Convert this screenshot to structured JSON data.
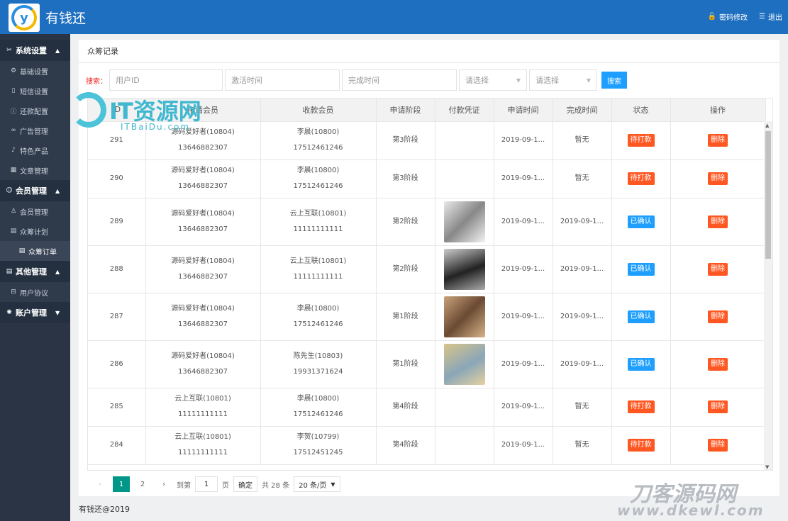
{
  "header": {
    "logo_letter": "y",
    "title": "有钱还",
    "pwd_link": "密码修改",
    "logout_link": "退出"
  },
  "sidebar": {
    "groups": [
      {
        "label": "系统设置",
        "items": [
          "基础设置",
          "短信设置",
          "还款配置",
          "广告管理",
          "特色产品",
          "文章管理"
        ]
      },
      {
        "label": "会员管理",
        "items": [
          "会员管理",
          "众筹计划",
          "众筹订单"
        ]
      },
      {
        "label": "其他管理",
        "items": [
          "用户协议"
        ]
      },
      {
        "label": "账户管理",
        "items": []
      }
    ]
  },
  "panel": {
    "title": "众筹记录"
  },
  "search": {
    "label": "搜索：",
    "user_id_placeholder": "用户ID",
    "activate_placeholder": "激活时间",
    "finish_placeholder": "完成时间",
    "select1": "请选择",
    "select2": "请选择",
    "button": "搜索"
  },
  "table": {
    "headers": [
      "ID",
      "申请会员",
      "收款会员",
      "申请阶段",
      "付款凭证",
      "申请时间",
      "完成时间",
      "状态",
      "操作"
    ],
    "rows": [
      {
        "id": "291",
        "applicant": "源码爱好者(10804)",
        "applicant_phone": "13646882307",
        "payee": "李晨(10800)",
        "payee_phone": "17512461246",
        "stage": "第3阶段",
        "apply": "2019-09-1...",
        "finish": "暂无",
        "status": "待打款",
        "action": "删除"
      },
      {
        "id": "290",
        "applicant": "源码爱好者(10804)",
        "applicant_phone": "13646882307",
        "payee": "李晨(10800)",
        "payee_phone": "17512461246",
        "stage": "第3阶段",
        "apply": "2019-09-1...",
        "finish": "暂无",
        "status": "待打款",
        "action": "删除"
      },
      {
        "id": "289",
        "applicant": "源码爱好者(10804)",
        "applicant_phone": "13646882307",
        "payee": "云上互联(10801)",
        "payee_phone": "11111111111",
        "stage": "第2阶段",
        "apply": "2019-09-1...",
        "finish": "2019-09-1...",
        "status": "已确认",
        "action": "删除"
      },
      {
        "id": "288",
        "applicant": "源码爱好者(10804)",
        "applicant_phone": "13646882307",
        "payee": "云上互联(10801)",
        "payee_phone": "11111111111",
        "stage": "第2阶段",
        "apply": "2019-09-1...",
        "finish": "2019-09-1...",
        "status": "已确认",
        "action": "删除"
      },
      {
        "id": "287",
        "applicant": "源码爱好者(10804)",
        "applicant_phone": "13646882307",
        "payee": "李晨(10800)",
        "payee_phone": "17512461246",
        "stage": "第1阶段",
        "apply": "2019-09-1...",
        "finish": "2019-09-1...",
        "status": "已确认",
        "action": "删除"
      },
      {
        "id": "286",
        "applicant": "源码爱好者(10804)",
        "applicant_phone": "13646882307",
        "payee": "陈先生(10803)",
        "payee_phone": "19931371624",
        "stage": "第1阶段",
        "apply": "2019-09-1...",
        "finish": "2019-09-1...",
        "status": "已确认",
        "action": "删除"
      },
      {
        "id": "285",
        "applicant": "云上互联(10801)",
        "applicant_phone": "11111111111",
        "payee": "李晨(10800)",
        "payee_phone": "17512461246",
        "stage": "第4阶段",
        "apply": "2019-09-1...",
        "finish": "暂无",
        "status": "待打款",
        "action": "删除"
      },
      {
        "id": "284",
        "applicant": "云上互联(10801)",
        "applicant_phone": "11111111111",
        "payee": "李贺(10799)",
        "payee_phone": "17512451245",
        "stage": "第4阶段",
        "apply": "2019-09-1...",
        "finish": "暂无",
        "status": "待打款",
        "action": "删除"
      }
    ]
  },
  "pager": {
    "page1": "1",
    "page2": "2",
    "goto": "到第",
    "goto_value": "1",
    "page_unit": "页",
    "ok": "确定",
    "total": "共 28 条",
    "size": "20 条/页"
  },
  "footer": "有钱还@2019",
  "watermarks": {
    "wm1": "IT资源网",
    "wm1_sub": "ITBaiDu.com",
    "wm2": "刀客源码网",
    "wm2_sub": "www.dkewl.com"
  },
  "colors": {
    "header": "#1e6fbf",
    "sidebar": "#2a3444",
    "orange": "#ff5722",
    "blue": "#1e9fff",
    "teal": "#009688"
  }
}
